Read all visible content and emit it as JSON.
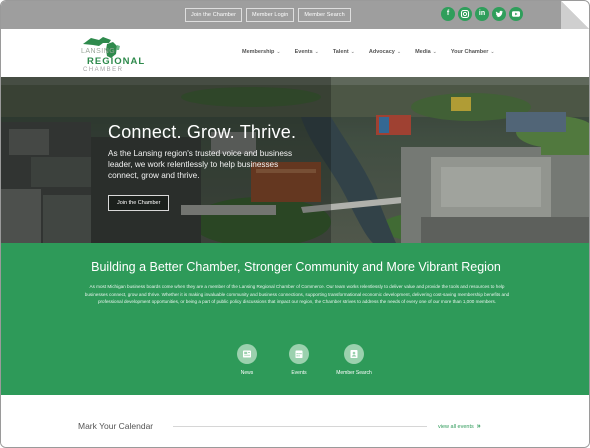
{
  "utility_bar": {
    "links": [
      "Join the Chamber",
      "Member Login",
      "Member Search"
    ],
    "social_icons": [
      "facebook-icon",
      "instagram-icon",
      "linkedin-icon",
      "twitter-icon",
      "youtube-icon"
    ],
    "social_color": "#2f9e5b"
  },
  "logo": {
    "line1": "LANSING",
    "line2": "REGIONAL",
    "line3": "CHAMBER",
    "brand_color": "#2e8a4c"
  },
  "nav": {
    "items": [
      "Membership",
      "Events",
      "Talent",
      "Advocacy",
      "Media",
      "Your Chamber"
    ]
  },
  "hero": {
    "title": "Connect. Grow. Thrive.",
    "text": "As the Lansing region's trusted voice and business leader, we work relentlessly to help businesses connect, grow and thrive.",
    "button_label": "Join the Chamber"
  },
  "band": {
    "title": "Building a Better Chamber, Stronger Community and More Vibrant Region",
    "body": "As most Michigan business boards come when they are a member of the Lansing Regional Chamber of Commerce. Our team works relentlessly to deliver value and provide the tools and resources to help businesses connect, grow and thrive. Whether it is making invaluable community and business connections, supporting transformational economic development, delivering cost-saving membership benefits and professional development opportunities, or being a part of public policy discussions that impact our region, the Chamber strives to address the needs of every one of our more than 1,000 members.",
    "color": "#2e9a59",
    "quick_links": [
      {
        "label": "News",
        "icon": "newspaper-icon"
      },
      {
        "label": "Events",
        "icon": "calendar-icon"
      },
      {
        "label": "Member Search",
        "icon": "member-card-icon"
      }
    ]
  },
  "calendar": {
    "title": "Mark Your Calendar",
    "link_label": "view all events",
    "link_arrows": "»"
  }
}
